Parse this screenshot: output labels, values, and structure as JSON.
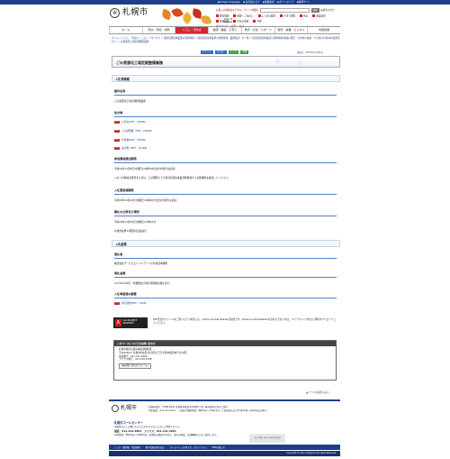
{
  "header": {
    "top_links": [
      "▶Foreign language",
      "▶音声読み上げ",
      "▶組織案内",
      "▶サイトマップ",
      "▶携帯サイト"
    ],
    "logo_text": "札幌市",
    "logo_sub": "City of Sapporo",
    "search_label": "お探しの情報はなですか。サイト内検索",
    "search_button": "検索",
    "detail_search": "▶検索の仕方",
    "quick_links": [
      "緊急情報",
      "健康・ごみ出し",
      "よくある質問",
      "子育て情報",
      "防災",
      "施設案内",
      "各種届出",
      "市長の部屋",
      "予算"
    ],
    "size_labels": [
      "文字サイズ",
      "標準",
      "拡大"
    ]
  },
  "nav": [
    "ホーム",
    "防災・防犯・消防",
    "くらし・手続き",
    "健康・福祉・子育て",
    "教育・文化・スポーツ",
    "観光・産業・ビジネス",
    "市政情報"
  ],
  "nav_active_index": 2,
  "breadcrumb": "ホーム > くらし・手続き > ごみ・リサイクル > 環境局環境事業部の契約情報 > 環境局環境事業部の契約情報（業務委託）の一覧 > 環境局環境事業部の契約情報(物品の販売・公用車の使用・その他)(平成29年度発注分) > ごみ資源化工場定期整備業務",
  "tools": [
    "ツイート",
    "いいね！",
    "シェア",
    "印刷"
  ],
  "updated": "更新日：2017年11月21日",
  "page_title": "ごみ資源化工場定期整備業務",
  "sections": {
    "nyusatsu": "入札等情報",
    "kekka": "入札結果"
  },
  "items": {
    "case_name_h": "案件名称",
    "case_name": "ごみ資源化工場定期整備業務",
    "notice_h": "告示等",
    "pdfs": [
      "公告文(PDF：100KB)",
      "入札説明書（PDF：206KB）",
      "仕様書(PDF：353KB)",
      "設計書（PDF：341KB）"
    ],
    "deadline_h": "参加資格提出期限",
    "deadline_1": "平成29年11月8日(水曜日)16時00分(送付の場合は必着)",
    "deadline_2": "入札への参加を希望する方は、上記期限までに環境局環境事業部総務課まで必要書類を提出してください。",
    "period_h": "入札書受領期限",
    "period": "平成29年11月16日(金曜日)16時00分(送付の場合は必着)",
    "open_h": "開札の日時及び場所",
    "open_1": "平成29年11月20日(金曜日)11時20分",
    "open_2": "札幌市役所12階環境局会議室",
    "winner_h": "落札者",
    "winner": "株式会社サービスエンジニアリング北海道事務所",
    "price_h": "落札金額",
    "price": "19,764,000円（消費税及び地方消費税の額を含む）",
    "record_h": "入札等経過の調書",
    "record_pdf": "執行調書(PDF：41KB)"
  },
  "adobe": {
    "badge": "Get ADOBE® READER®",
    "msg": "PDF形式のファイルをご覧いただく場合には、Adobe Acrobat Readerが必要です。Adobe Acrobat Readerをお持ちでない方は、バナーのリンク先から無料ダウンロードしてください。"
  },
  "contact": {
    "title": "このページについてのお問い合わせ",
    "lines": [
      "札幌市環境局環境事業部総務課",
      "〒060-8611 札幌市中央区北1条西2丁目 札幌市役所本庁舎12階",
      "電話番号：011-211-2906",
      "ファクス番号：011-218-5108"
    ],
    "form": "▶お問い合わせフォーム"
  },
  "page_top": "▲ページの先頭へ戻る",
  "footer": {
    "name": "札幌市",
    "addr_1": "札幌市役所　〒060-8611 札幌市中央区北1条西2丁目　▶市役所庁舎のご案内",
    "addr_2": "代表電話：011-211-2111　一般的な業務時間：8時45分～17時15分（土日祝日および12月29日～1月3日はお休み）",
    "call_title": "札幌市コールセンター",
    "call_desc": "市役所のどこに聞いたらよいかわからないときにご利用ください。",
    "call_tel": "電話：011-222-4894　ファクス：011-221-4894",
    "call_hours": "年中無休、8時00分～21時00分。札幌市の制度や手続き、市内の施設、交通機関などをご案内します。",
    "call_access": "コールセンターへのアクセス",
    "nav": [
      "リンク・著作権・免責事項",
      "個人情報の取り扱い",
      "ホームページの考え方・ガイドライン",
      "RSSの使い方"
    ],
    "copy": "Copyright © City of Sapporo All rights Reserved."
  }
}
